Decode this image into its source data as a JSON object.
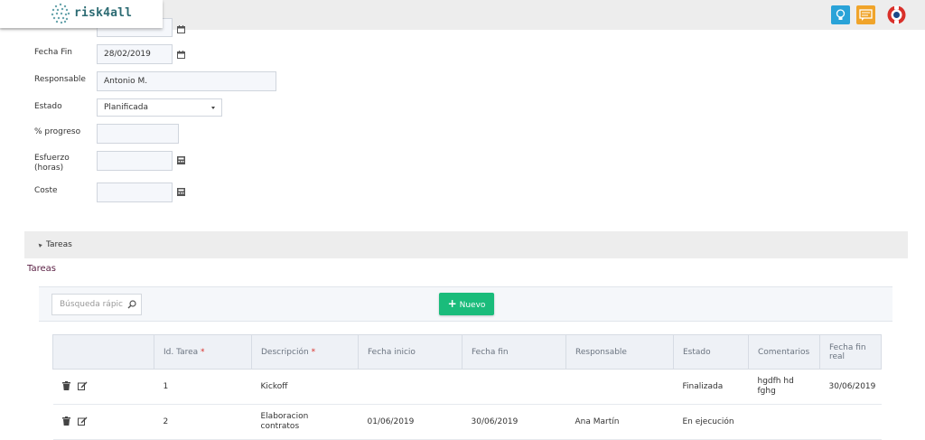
{
  "header": {
    "app_name": "risk4all",
    "icons": [
      "menu-icon",
      "lightbulb-icon",
      "message-icon",
      "help-icon"
    ],
    "colors": {
      "bulb": "#2aa3d8",
      "message": "#f0a42a",
      "help": "#d9302a"
    }
  },
  "form": {
    "fecha_fin_label": "Fecha Fin",
    "fecha_fin_value": "28/02/2019",
    "responsable_label": "Responsable",
    "responsable_value": "Antonio M.",
    "estado_label": "Estado",
    "estado_value": "Planificada",
    "progreso_label": "% progreso",
    "progreso_value": "",
    "esfuerzo_label_1": "Esfuerzo",
    "esfuerzo_label_2": "(horas)",
    "esfuerzo_value": "",
    "coste_label": "Coste",
    "coste_value": ""
  },
  "tareas": {
    "section_title": "Tareas",
    "subtitle": "Tareas",
    "search_placeholder": "Búsqueda rápic",
    "new_button": "Nuevo",
    "columns": [
      "",
      "Id. Tarea",
      "Descripción",
      "Fecha inicio",
      "Fecha fin",
      "Responsable",
      "Estado",
      "Comentarios",
      "Fecha fin real"
    ],
    "required_marker": "*",
    "rows": [
      {
        "id": "1",
        "descripcion": "Kickoff",
        "fecha_inicio": "",
        "fecha_fin": "",
        "responsable": "",
        "estado": "Finalizada",
        "comentarios": "hgdfh hd fghg",
        "fecha_fin_real": "30/06/2019"
      },
      {
        "id": "2",
        "descripcion": "Elaboracion contratos",
        "fecha_inicio": "01/06/2019",
        "fecha_fin": "30/06/2019",
        "responsable": "Ana Martín",
        "estado": "En ejecución",
        "comentarios": "",
        "fecha_fin_real": ""
      }
    ]
  },
  "colors": {
    "accent": "#1abc7b",
    "subtitle": "#5b2145"
  }
}
